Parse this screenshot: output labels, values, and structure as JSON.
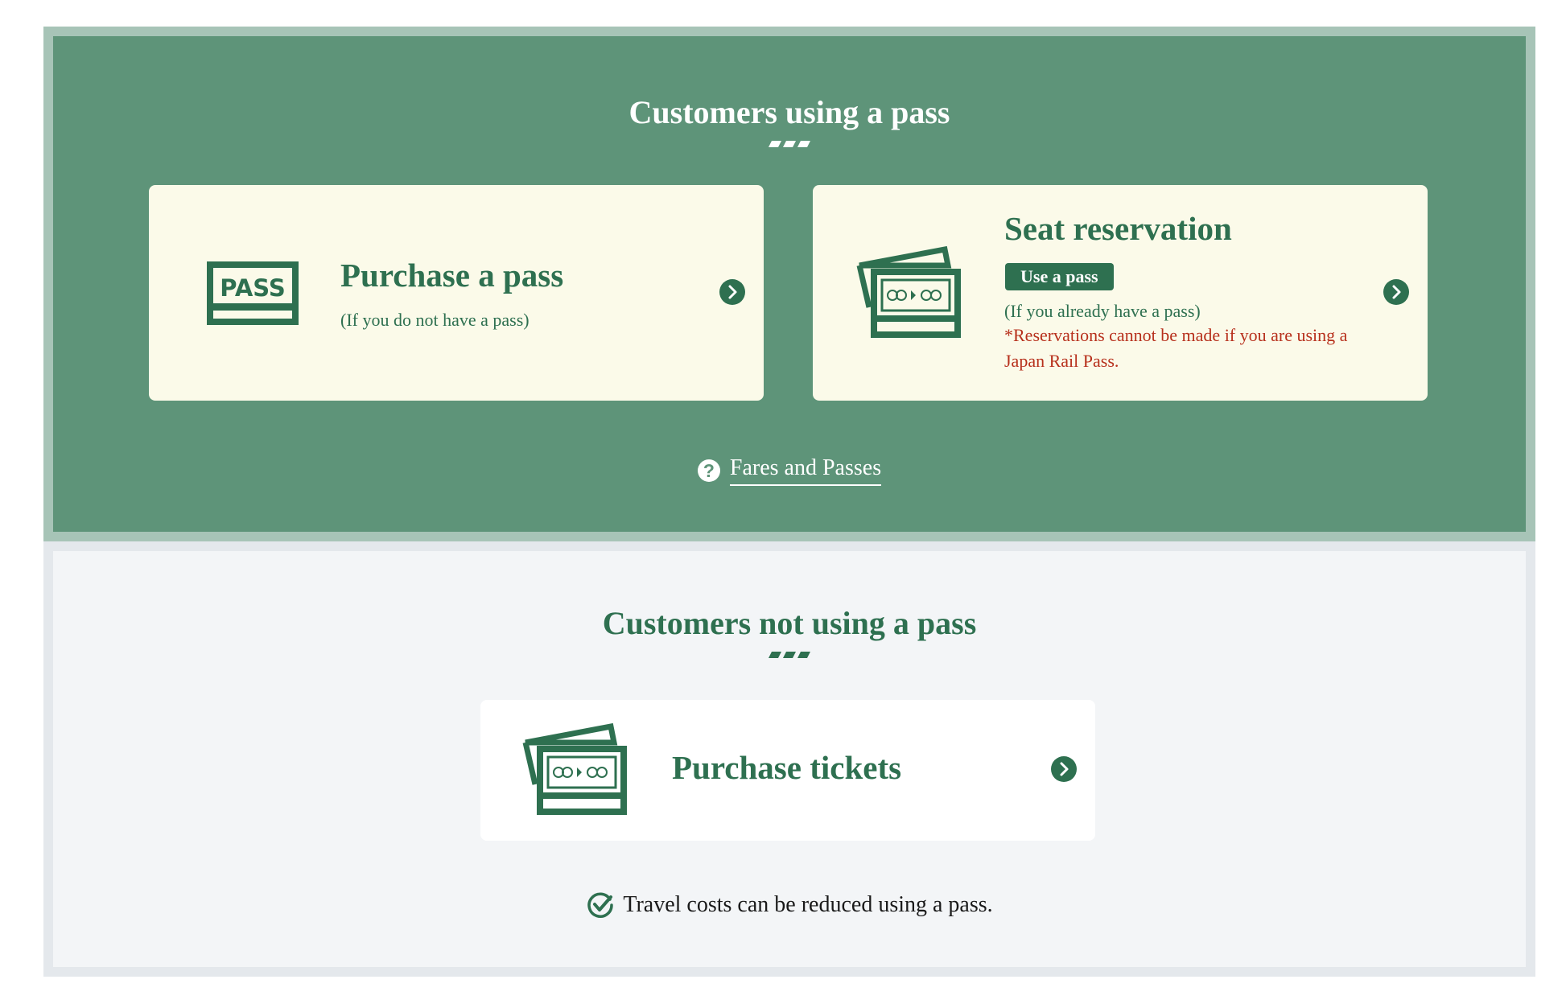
{
  "colors": {
    "pass_section_bg": "#5e9479",
    "pass_section_border": "#a7c4b7",
    "no_pass_section_bg": "#f3f5f7",
    "brand_green": "#2e7050",
    "card_cream": "#fbfae9",
    "warning_red": "#b7301c"
  },
  "pass_section": {
    "title": "Customers using a pass",
    "cards": [
      {
        "icon": "pass-card-icon",
        "icon_text": "PASS",
        "title": "Purchase a pass",
        "subtitle": "(If you do not have a pass)"
      },
      {
        "icon": "ticket-icon",
        "title": "Seat reservation",
        "badge": "Use a pass",
        "subtitle": "(If you already have a pass)",
        "warning": "*Reservations cannot be made if you are using a Japan Rail Pass."
      }
    ],
    "help_link": {
      "icon": "question-icon",
      "label": "Fares and Passes"
    }
  },
  "no_pass_section": {
    "title": "Customers not using a pass",
    "card": {
      "icon": "ticket-icon",
      "title": "Purchase tickets"
    },
    "note": {
      "icon": "check-circle-icon",
      "text": "Travel costs can be reduced using a pass."
    }
  }
}
